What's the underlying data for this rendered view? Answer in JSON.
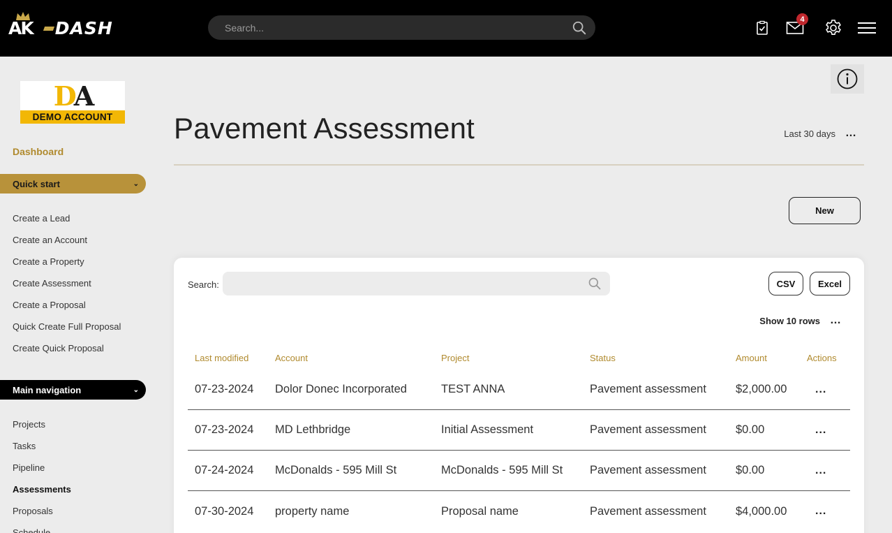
{
  "header": {
    "logo_left": "AK",
    "logo_right": "DASH",
    "search_placeholder": "Search...",
    "mail_badge": "4",
    "icons": [
      "checklist-icon",
      "mail-icon",
      "gear-icon",
      "menu-icon",
      "search-icon"
    ]
  },
  "sidebar": {
    "brand": {
      "mark_d": "D",
      "mark_a": "A",
      "caption": "DEMO ACCOUNT"
    },
    "dashboard": "Dashboard",
    "quick_start": {
      "label": "Quick start",
      "items": [
        "Create a Lead",
        "Create an Account",
        "Create a Property",
        "Create Assessment",
        "Create a Proposal",
        "Quick Create Full Proposal",
        "Create Quick Proposal"
      ]
    },
    "main_navigation": {
      "label": "Main navigation",
      "items": [
        "Projects",
        "Tasks",
        "Pipeline",
        "Assessments",
        "Proposals",
        "Schedule"
      ],
      "active": "Assessments"
    }
  },
  "page": {
    "title": "Pavement Assessment",
    "date_range": "Last 30 days",
    "new_label": "New"
  },
  "table": {
    "search_label": "Search:",
    "csv_label": "CSV",
    "excel_label": "Excel",
    "show_rows": "Show 10 rows",
    "columns": [
      "Last modified",
      "Account",
      "Project",
      "Status",
      "Amount",
      "Actions"
    ],
    "rows": [
      {
        "last_modified": "07-23-2024",
        "account": "Dolor Donec Incorporated",
        "project": "TEST ANNA",
        "status": "Pavement assessment",
        "amount": "$2,000.00"
      },
      {
        "last_modified": "07-23-2024",
        "account": "MD Lethbridge",
        "project": "Initial Assessment",
        "status": "Pavement assessment",
        "amount": "$0.00"
      },
      {
        "last_modified": "07-24-2024",
        "account": "McDonalds - 595 Mill St",
        "project": "McDonalds - 595 Mill St",
        "status": "Pavement assessment",
        "amount": "$0.00"
      },
      {
        "last_modified": "07-30-2024",
        "account": "property name",
        "project": "Proposal name",
        "status": "Pavement assessment",
        "amount": "$4,000.00"
      }
    ],
    "row_action_label": "..."
  },
  "colors": {
    "gold": "#b8923a",
    "gold_text": "#b08a2e",
    "topbar": "#000000",
    "badge": "#c0272d",
    "background": "#ececec"
  }
}
